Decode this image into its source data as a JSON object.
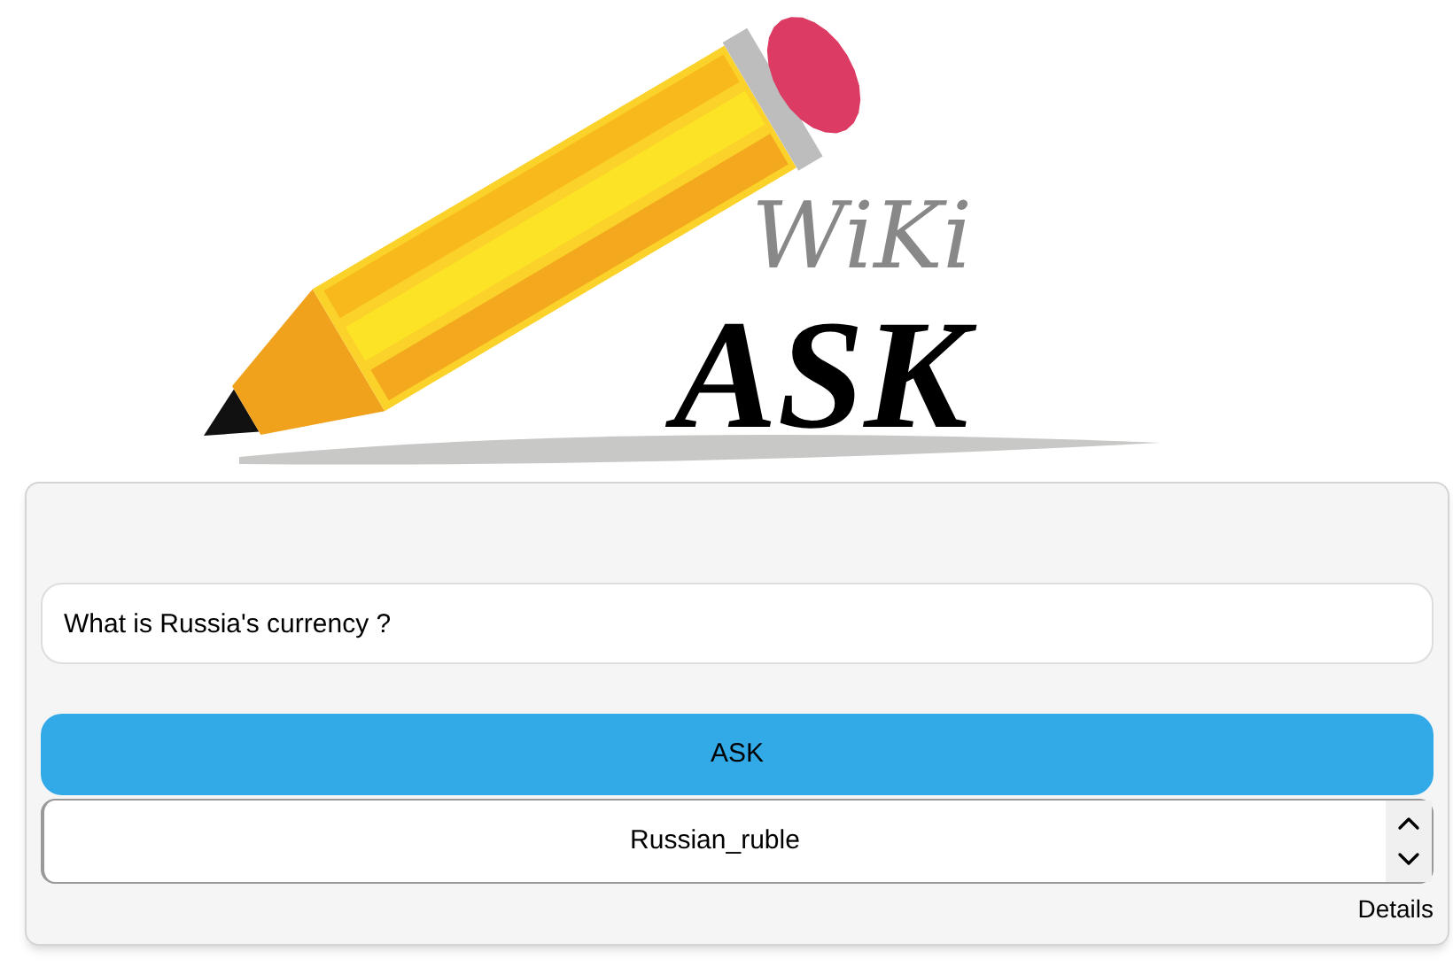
{
  "logo": {
    "line_1": "WiKi",
    "line_2": "ASK"
  },
  "question": {
    "value": "What is Russia's currency ?"
  },
  "ask_button": "ASK",
  "answer": {
    "value": "Russian_ruble"
  },
  "details_link": "Details"
}
